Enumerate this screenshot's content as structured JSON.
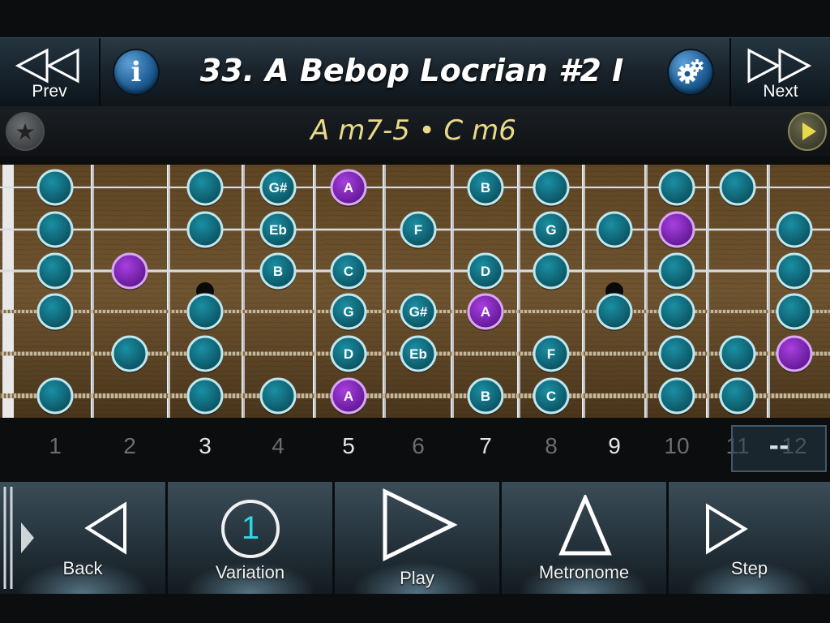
{
  "header": {
    "title": "33. A Bebop Locrian #2 I",
    "prev_label": "Prev",
    "next_label": "Next",
    "info_icon": "info-icon",
    "settings_icon": "gear-icon"
  },
  "chord_bar": {
    "chords": "A m7-5 • C m6",
    "favorite_icon": "star-icon",
    "play_icon": "play-icon"
  },
  "fretboard": {
    "notes": [
      {
        "string": 1,
        "fret": 1,
        "label": "",
        "type": "teal"
      },
      {
        "string": 1,
        "fret": 3,
        "label": "",
        "type": "teal"
      },
      {
        "string": 1,
        "fret": 4,
        "label": "G#",
        "type": "teal"
      },
      {
        "string": 1,
        "fret": 5,
        "label": "A",
        "type": "purple"
      },
      {
        "string": 1,
        "fret": 7,
        "label": "B",
        "type": "teal"
      },
      {
        "string": 1,
        "fret": 8,
        "label": "",
        "type": "teal"
      },
      {
        "string": 1,
        "fret": 10,
        "label": "",
        "type": "teal"
      },
      {
        "string": 1,
        "fret": 11,
        "label": "",
        "type": "teal"
      },
      {
        "string": 2,
        "fret": 1,
        "label": "",
        "type": "teal"
      },
      {
        "string": 2,
        "fret": 3,
        "label": "",
        "type": "teal"
      },
      {
        "string": 2,
        "fret": 4,
        "label": "Eb",
        "type": "teal"
      },
      {
        "string": 2,
        "fret": 6,
        "label": "F",
        "type": "teal"
      },
      {
        "string": 2,
        "fret": 8,
        "label": "G",
        "type": "teal"
      },
      {
        "string": 2,
        "fret": 9,
        "label": "",
        "type": "teal"
      },
      {
        "string": 2,
        "fret": 10,
        "label": "",
        "type": "purple"
      },
      {
        "string": 2,
        "fret": 12,
        "label": "",
        "type": "teal"
      },
      {
        "string": 3,
        "fret": 1,
        "label": "",
        "type": "teal"
      },
      {
        "string": 3,
        "fret": 2,
        "label": "",
        "type": "purple"
      },
      {
        "string": 3,
        "fret": 4,
        "label": "B",
        "type": "teal"
      },
      {
        "string": 3,
        "fret": 5,
        "label": "C",
        "type": "teal"
      },
      {
        "string": 3,
        "fret": 7,
        "label": "D",
        "type": "teal"
      },
      {
        "string": 3,
        "fret": 8,
        "label": "",
        "type": "teal"
      },
      {
        "string": 3,
        "fret": 10,
        "label": "",
        "type": "teal"
      },
      {
        "string": 3,
        "fret": 12,
        "label": "",
        "type": "teal"
      },
      {
        "string": 4,
        "fret": 1,
        "label": "",
        "type": "teal"
      },
      {
        "string": 4,
        "fret": 3,
        "label": "",
        "type": "teal"
      },
      {
        "string": 4,
        "fret": 5,
        "label": "G",
        "type": "teal"
      },
      {
        "string": 4,
        "fret": 6,
        "label": "G#",
        "type": "teal"
      },
      {
        "string": 4,
        "fret": 7,
        "label": "A",
        "type": "purple"
      },
      {
        "string": 4,
        "fret": 9,
        "label": "",
        "type": "teal"
      },
      {
        "string": 4,
        "fret": 10,
        "label": "",
        "type": "teal"
      },
      {
        "string": 4,
        "fret": 12,
        "label": "",
        "type": "teal"
      },
      {
        "string": 5,
        "fret": 2,
        "label": "",
        "type": "teal"
      },
      {
        "string": 5,
        "fret": 3,
        "label": "",
        "type": "teal"
      },
      {
        "string": 5,
        "fret": 5,
        "label": "D",
        "type": "teal"
      },
      {
        "string": 5,
        "fret": 6,
        "label": "Eb",
        "type": "teal"
      },
      {
        "string": 5,
        "fret": 8,
        "label": "F",
        "type": "teal"
      },
      {
        "string": 5,
        "fret": 10,
        "label": "",
        "type": "teal"
      },
      {
        "string": 5,
        "fret": 11,
        "label": "",
        "type": "teal"
      },
      {
        "string": 5,
        "fret": 12,
        "label": "",
        "type": "purple"
      },
      {
        "string": 6,
        "fret": 1,
        "label": "",
        "type": "teal"
      },
      {
        "string": 6,
        "fret": 3,
        "label": "",
        "type": "teal"
      },
      {
        "string": 6,
        "fret": 4,
        "label": "",
        "type": "teal"
      },
      {
        "string": 6,
        "fret": 5,
        "label": "A",
        "type": "purple"
      },
      {
        "string": 6,
        "fret": 7,
        "label": "B",
        "type": "teal"
      },
      {
        "string": 6,
        "fret": 8,
        "label": "C",
        "type": "teal"
      },
      {
        "string": 6,
        "fret": 10,
        "label": "",
        "type": "teal"
      },
      {
        "string": 6,
        "fret": 11,
        "label": "",
        "type": "teal"
      }
    ],
    "inlays": [
      3,
      9
    ],
    "colors": {
      "teal": "#0f6f82",
      "purple": "#8e2bc4",
      "wood": "#7a5a2e"
    }
  },
  "fret_numbers": [
    {
      "n": "1",
      "bright": false
    },
    {
      "n": "2",
      "bright": false
    },
    {
      "n": "3",
      "bright": true
    },
    {
      "n": "4",
      "bright": false
    },
    {
      "n": "5",
      "bright": true
    },
    {
      "n": "6",
      "bright": false
    },
    {
      "n": "7",
      "bright": true
    },
    {
      "n": "8",
      "bright": false
    },
    {
      "n": "9",
      "bright": true
    },
    {
      "n": "10",
      "bright": false
    },
    {
      "n": "11",
      "bright": false
    },
    {
      "n": "12",
      "bright": false
    }
  ],
  "range_box": "--",
  "controls": {
    "back_label": "Back",
    "variation_label": "Variation",
    "variation_value": "1",
    "play_label": "Play",
    "metronome_label": "Metronome",
    "step_label": "Step"
  }
}
